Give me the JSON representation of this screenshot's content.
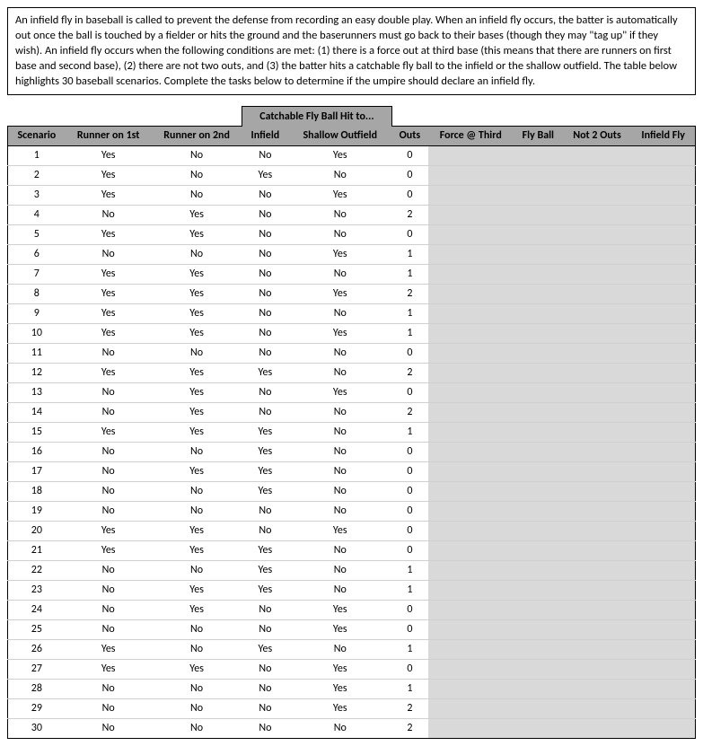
{
  "instructions": "An infield fly in baseball is called to prevent the defense from recording an easy double play. When an infield fly occurs, the batter is automatically out once the ball is touched by a fielder or hits the ground and the baserunners must go back to their bases (though they may \"tag up\" if they wish). An infield fly occurs when the following conditions are met: (1) there is a force out at third base (this means that there are runners on first base and second base), (2) there are not two outs, and (3) the batter hits a catchable fly ball to the infield or the shallow outfield. The table below highlights 30 baseball scenarios. Complete the tasks below to determine if the umpire should declare an infield fly.",
  "headers": {
    "scenario": "Scenario",
    "r1": "Runner on 1st",
    "r2": "Runner on 2nd",
    "merged": "Catchable Fly Ball Hit to...",
    "infield": "Infield",
    "shallow": "Shallow Outfield",
    "outs": "Outs",
    "force": "Force @ Third",
    "flyball": "Fly Ball",
    "not2": "Not 2 Outs",
    "infieldfly": "Infield Fly"
  },
  "rows": [
    {
      "s": 1,
      "r1": "Yes",
      "r2": "No",
      "inf": "No",
      "so": "Yes",
      "o": 0
    },
    {
      "s": 2,
      "r1": "Yes",
      "r2": "No",
      "inf": "Yes",
      "so": "No",
      "o": 0
    },
    {
      "s": 3,
      "r1": "Yes",
      "r2": "No",
      "inf": "No",
      "so": "Yes",
      "o": 0
    },
    {
      "s": 4,
      "r1": "No",
      "r2": "Yes",
      "inf": "No",
      "so": "No",
      "o": 2
    },
    {
      "s": 5,
      "r1": "Yes",
      "r2": "Yes",
      "inf": "No",
      "so": "No",
      "o": 0
    },
    {
      "s": 6,
      "r1": "No",
      "r2": "No",
      "inf": "No",
      "so": "Yes",
      "o": 1
    },
    {
      "s": 7,
      "r1": "Yes",
      "r2": "Yes",
      "inf": "No",
      "so": "No",
      "o": 1
    },
    {
      "s": 8,
      "r1": "Yes",
      "r2": "Yes",
      "inf": "No",
      "so": "Yes",
      "o": 2
    },
    {
      "s": 9,
      "r1": "Yes",
      "r2": "Yes",
      "inf": "No",
      "so": "No",
      "o": 1
    },
    {
      "s": 10,
      "r1": "Yes",
      "r2": "Yes",
      "inf": "No",
      "so": "Yes",
      "o": 1
    },
    {
      "s": 11,
      "r1": "No",
      "r2": "No",
      "inf": "No",
      "so": "No",
      "o": 0
    },
    {
      "s": 12,
      "r1": "Yes",
      "r2": "Yes",
      "inf": "Yes",
      "so": "No",
      "o": 2
    },
    {
      "s": 13,
      "r1": "No",
      "r2": "Yes",
      "inf": "No",
      "so": "Yes",
      "o": 0
    },
    {
      "s": 14,
      "r1": "No",
      "r2": "Yes",
      "inf": "No",
      "so": "No",
      "o": 2
    },
    {
      "s": 15,
      "r1": "Yes",
      "r2": "Yes",
      "inf": "Yes",
      "so": "No",
      "o": 1
    },
    {
      "s": 16,
      "r1": "No",
      "r2": "No",
      "inf": "Yes",
      "so": "No",
      "o": 0
    },
    {
      "s": 17,
      "r1": "No",
      "r2": "Yes",
      "inf": "Yes",
      "so": "No",
      "o": 0
    },
    {
      "s": 18,
      "r1": "No",
      "r2": "No",
      "inf": "Yes",
      "so": "No",
      "o": 0
    },
    {
      "s": 19,
      "r1": "No",
      "r2": "No",
      "inf": "No",
      "so": "No",
      "o": 0
    },
    {
      "s": 20,
      "r1": "Yes",
      "r2": "Yes",
      "inf": "No",
      "so": "Yes",
      "o": 0
    },
    {
      "s": 21,
      "r1": "Yes",
      "r2": "Yes",
      "inf": "Yes",
      "so": "No",
      "o": 0
    },
    {
      "s": 22,
      "r1": "No",
      "r2": "No",
      "inf": "Yes",
      "so": "No",
      "o": 1
    },
    {
      "s": 23,
      "r1": "No",
      "r2": "Yes",
      "inf": "Yes",
      "so": "No",
      "o": 1
    },
    {
      "s": 24,
      "r1": "No",
      "r2": "Yes",
      "inf": "No",
      "so": "Yes",
      "o": 0
    },
    {
      "s": 25,
      "r1": "No",
      "r2": "No",
      "inf": "No",
      "so": "Yes",
      "o": 0
    },
    {
      "s": 26,
      "r1": "Yes",
      "r2": "No",
      "inf": "Yes",
      "so": "No",
      "o": 1
    },
    {
      "s": 27,
      "r1": "Yes",
      "r2": "Yes",
      "inf": "No",
      "so": "Yes",
      "o": 0
    },
    {
      "s": 28,
      "r1": "No",
      "r2": "No",
      "inf": "No",
      "so": "Yes",
      "o": 1
    },
    {
      "s": 29,
      "r1": "No",
      "r2": "No",
      "inf": "No",
      "so": "Yes",
      "o": 2
    },
    {
      "s": 30,
      "r1": "No",
      "r2": "No",
      "inf": "No",
      "so": "No",
      "o": 2
    }
  ]
}
